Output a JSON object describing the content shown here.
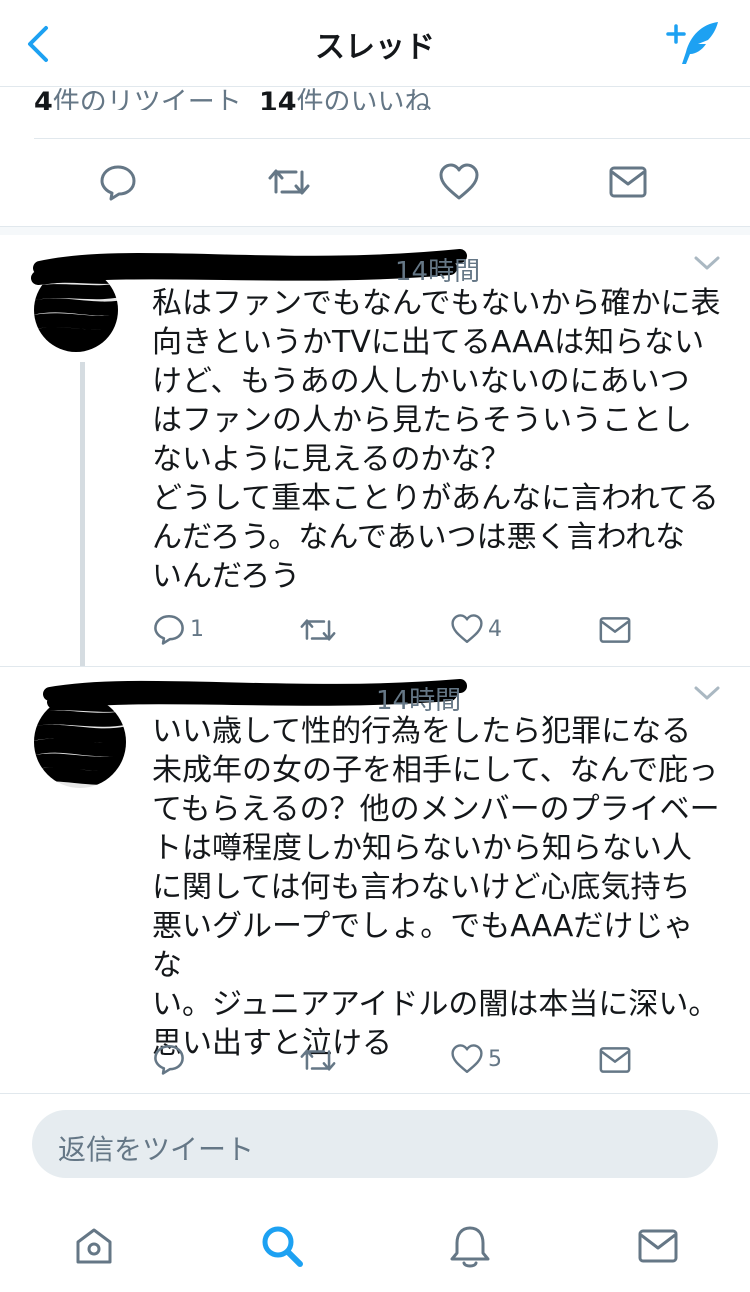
{
  "header": {
    "title": "スレッド",
    "back_icon": "chevron-left-icon",
    "compose_icon": "compose-tweet-icon",
    "accent": "#1da1f2"
  },
  "stats": {
    "retweet_count": "4",
    "retweet_label": "件のリツイート",
    "like_count": "14",
    "like_label": "件のいいね"
  },
  "replies": [
    {
      "time": "14時間",
      "text": "私はファンでもなんでもないから確かに表\n向きというかTVに出てるAAAは知らない\nけど、もうあの人しかいないのにあいつ\nはファンの人から見たらそういうことし\nないように見えるのかな？\nどうして重本ことりがあんなに言われてる\nんだろう。なんであいつは悪く言われな\nいんだろう",
      "reply_count": "1",
      "like_count": "4"
    },
    {
      "time": "14時間",
      "text": "いい歳して性的行為をしたら犯罪になる\n未成年の女の子を相手にして、なんで庇っ\nてもらえるの？他のメンバーのプライベー\nトは噂程度しか知らないから知らない人\nに関しては何も言わないけど心底気持ち\n悪いグループでしょ。でもAAAだけじゃな\nい。ジュニアアイドルの闇は本当に深い。\n思い出すと泣ける",
      "like_count": "5"
    }
  ],
  "composer": {
    "placeholder": "返信をツイート"
  },
  "tabbar": {
    "items": [
      "home-icon",
      "search-icon",
      "notifications-icon",
      "messages-icon"
    ],
    "active": "search-icon"
  }
}
